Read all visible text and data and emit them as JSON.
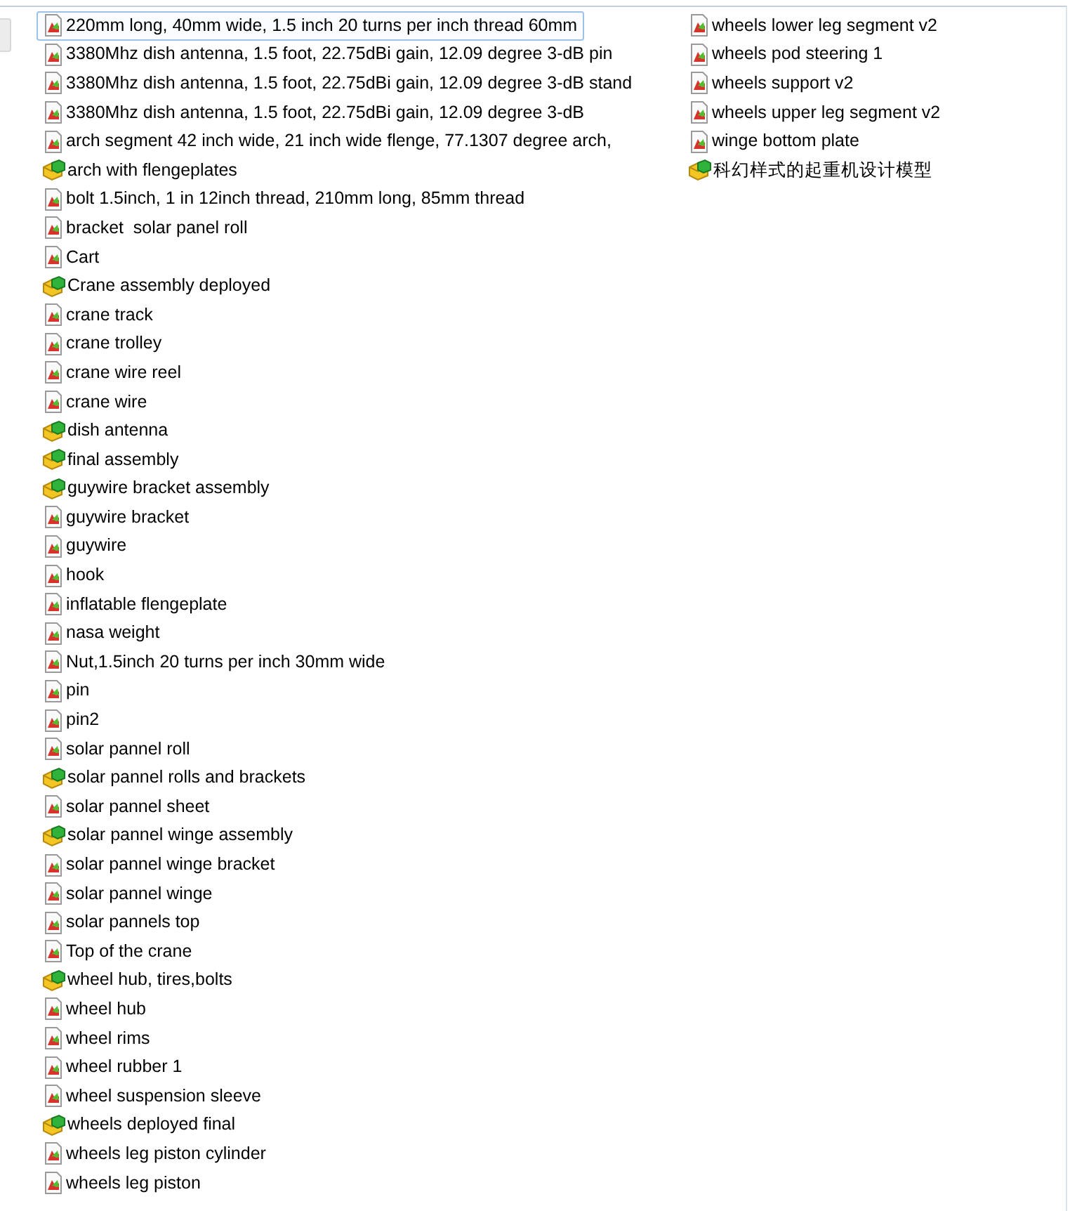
{
  "columns": [
    {
      "items": [
        {
          "name": "220mm long, 40mm wide, 1.5 inch 20 turns per inch thread 60mm",
          "kind": "part",
          "selected": true
        },
        {
          "name": "3380Mhz dish antenna, 1.5 foot, 22.75dBi gain, 12.09 degree 3-dB pin",
          "kind": "part",
          "selected": false
        },
        {
          "name": "3380Mhz dish antenna, 1.5 foot, 22.75dBi gain, 12.09 degree 3-dB stand",
          "kind": "part",
          "selected": false
        },
        {
          "name": "3380Mhz dish antenna, 1.5 foot, 22.75dBi gain, 12.09 degree 3-dB",
          "kind": "part",
          "selected": false
        },
        {
          "name": "arch segment 42 inch wide, 21 inch wide flenge, 77.1307 degree arch,",
          "kind": "part",
          "selected": false
        },
        {
          "name": "arch with flengeplates",
          "kind": "assembly",
          "selected": false
        },
        {
          "name": "bolt 1.5inch, 1 in 12inch thread, 210mm long, 85mm thread",
          "kind": "part",
          "selected": false
        },
        {
          "name": "bracket  solar panel roll",
          "kind": "part",
          "selected": false
        },
        {
          "name": "Cart",
          "kind": "part",
          "selected": false
        },
        {
          "name": "Crane assembly deployed",
          "kind": "assembly",
          "selected": false
        },
        {
          "name": "crane track",
          "kind": "part",
          "selected": false
        },
        {
          "name": "crane trolley",
          "kind": "part",
          "selected": false
        },
        {
          "name": "crane wire reel",
          "kind": "part",
          "selected": false
        },
        {
          "name": "crane wire",
          "kind": "part",
          "selected": false
        },
        {
          "name": "dish antenna",
          "kind": "assembly",
          "selected": false
        },
        {
          "name": "final assembly",
          "kind": "assembly",
          "selected": false
        },
        {
          "name": "guywire bracket assembly",
          "kind": "assembly",
          "selected": false
        },
        {
          "name": "guywire bracket",
          "kind": "part",
          "selected": false
        },
        {
          "name": "guywire",
          "kind": "part",
          "selected": false
        },
        {
          "name": "hook",
          "kind": "part",
          "selected": false
        },
        {
          "name": "inflatable flengeplate",
          "kind": "part",
          "selected": false
        },
        {
          "name": "nasa weight",
          "kind": "part",
          "selected": false
        },
        {
          "name": "Nut,1.5inch 20 turns per inch 30mm wide",
          "kind": "part",
          "selected": false
        },
        {
          "name": "pin",
          "kind": "part",
          "selected": false
        },
        {
          "name": "pin2",
          "kind": "part",
          "selected": false
        },
        {
          "name": "solar pannel roll",
          "kind": "part",
          "selected": false
        },
        {
          "name": "solar pannel rolls and brackets",
          "kind": "assembly",
          "selected": false
        },
        {
          "name": "solar pannel sheet",
          "kind": "part",
          "selected": false
        },
        {
          "name": "solar pannel winge assembly",
          "kind": "assembly",
          "selected": false
        },
        {
          "name": "solar pannel winge bracket",
          "kind": "part",
          "selected": false
        },
        {
          "name": "solar pannel winge",
          "kind": "part",
          "selected": false
        },
        {
          "name": "solar pannels top",
          "kind": "part",
          "selected": false
        },
        {
          "name": "Top of the crane",
          "kind": "part",
          "selected": false
        },
        {
          "name": "wheel hub, tires,bolts",
          "kind": "assembly",
          "selected": false
        },
        {
          "name": "wheel hub",
          "kind": "part",
          "selected": false
        },
        {
          "name": "wheel rims",
          "kind": "part",
          "selected": false
        },
        {
          "name": "wheel rubber 1",
          "kind": "part",
          "selected": false
        },
        {
          "name": "wheel suspension sleeve",
          "kind": "part",
          "selected": false
        },
        {
          "name": "wheels deployed final",
          "kind": "assembly",
          "selected": false
        },
        {
          "name": "wheels leg piston cylinder",
          "kind": "part",
          "selected": false
        },
        {
          "name": "wheels leg piston",
          "kind": "part",
          "selected": false
        }
      ]
    },
    {
      "items": [
        {
          "name": "wheels lower leg segment v2",
          "kind": "part",
          "selected": false
        },
        {
          "name": "wheels pod steering 1",
          "kind": "part",
          "selected": false
        },
        {
          "name": "wheels support v2",
          "kind": "part",
          "selected": false
        },
        {
          "name": "wheels upper leg segment v2",
          "kind": "part",
          "selected": false
        },
        {
          "name": "winge bottom plate",
          "kind": "part",
          "selected": false
        },
        {
          "name": "科幻样式的起重机设计模型",
          "kind": "assembly",
          "selected": false
        }
      ]
    }
  ]
}
